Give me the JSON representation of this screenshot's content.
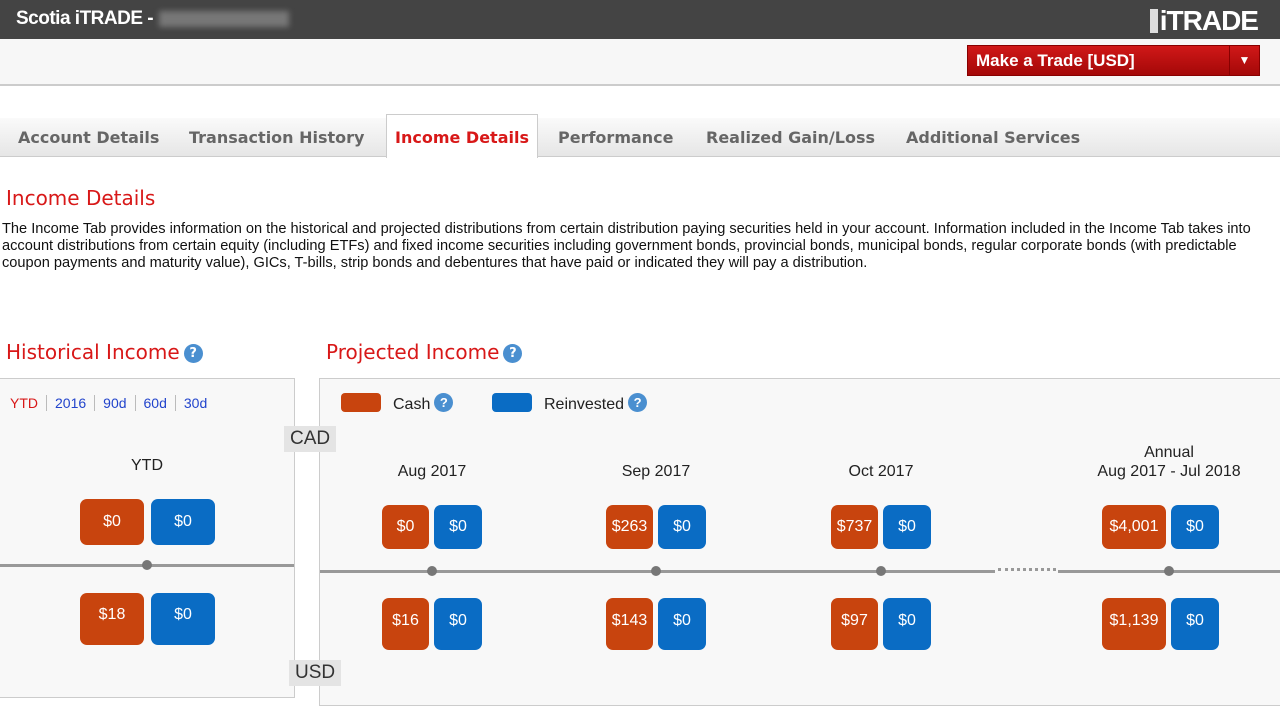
{
  "header": {
    "title": "Scotia iTRADE -",
    "logo": "iTRADE"
  },
  "trade_button": {
    "label": "Make a Trade [USD]",
    "caret": "▼"
  },
  "tabs": [
    "Account Details",
    "Transaction History",
    "Income Details",
    "Performance",
    "Realized Gain/Loss",
    "Additional Services"
  ],
  "active_tab": "Income Details",
  "page": {
    "title": "Income Details",
    "description": "The Income Tab provides information on the historical and projected distributions from certain distribution paying securities held in your account. Information included in the Income Tab takes into account distributions from certain equity (including ETFs) and fixed income securities including government bonds, provincial bonds, municipal bonds, regular corporate bonds (with predictable coupon payments and maturity value), GICs, T-bills, strip bonds and debentures that have paid or indicated they will pay a distribution."
  },
  "historical": {
    "title": "Historical Income",
    "help": "?",
    "periods": [
      "YTD",
      "2016",
      "90d",
      "60d",
      "30d"
    ],
    "selected_period": "YTD",
    "label": "YTD",
    "cad_cash": "$0",
    "cad_reinvested": "$0",
    "usd_cash": "$18",
    "usd_reinvested": "$0"
  },
  "currencies": {
    "top": "CAD",
    "bottom": "USD"
  },
  "projected": {
    "title": "Projected Income",
    "help": "?",
    "legend": {
      "cash": "Cash",
      "reinvested": "Reinvested",
      "cash_color": "#c8440e",
      "reinvested_color": "#0a6cc4"
    },
    "columns": [
      {
        "label": "Aug 2017",
        "cad_cash": "$0",
        "cad_reinvested": "$0",
        "usd_cash": "$16",
        "usd_reinvested": "$0"
      },
      {
        "label": "Sep 2017",
        "cad_cash": "$263",
        "cad_reinvested": "$0",
        "usd_cash": "$143",
        "usd_reinvested": "$0"
      },
      {
        "label": "Oct 2017",
        "cad_cash": "$737",
        "cad_reinvested": "$0",
        "usd_cash": "$97",
        "usd_reinvested": "$0"
      },
      {
        "label": "Annual",
        "sublabel": "Aug 2017 - Jul 2018",
        "cad_cash": "$4,001",
        "cad_reinvested": "$0",
        "usd_cash": "$1,139",
        "usd_reinvested": "$0"
      }
    ]
  }
}
